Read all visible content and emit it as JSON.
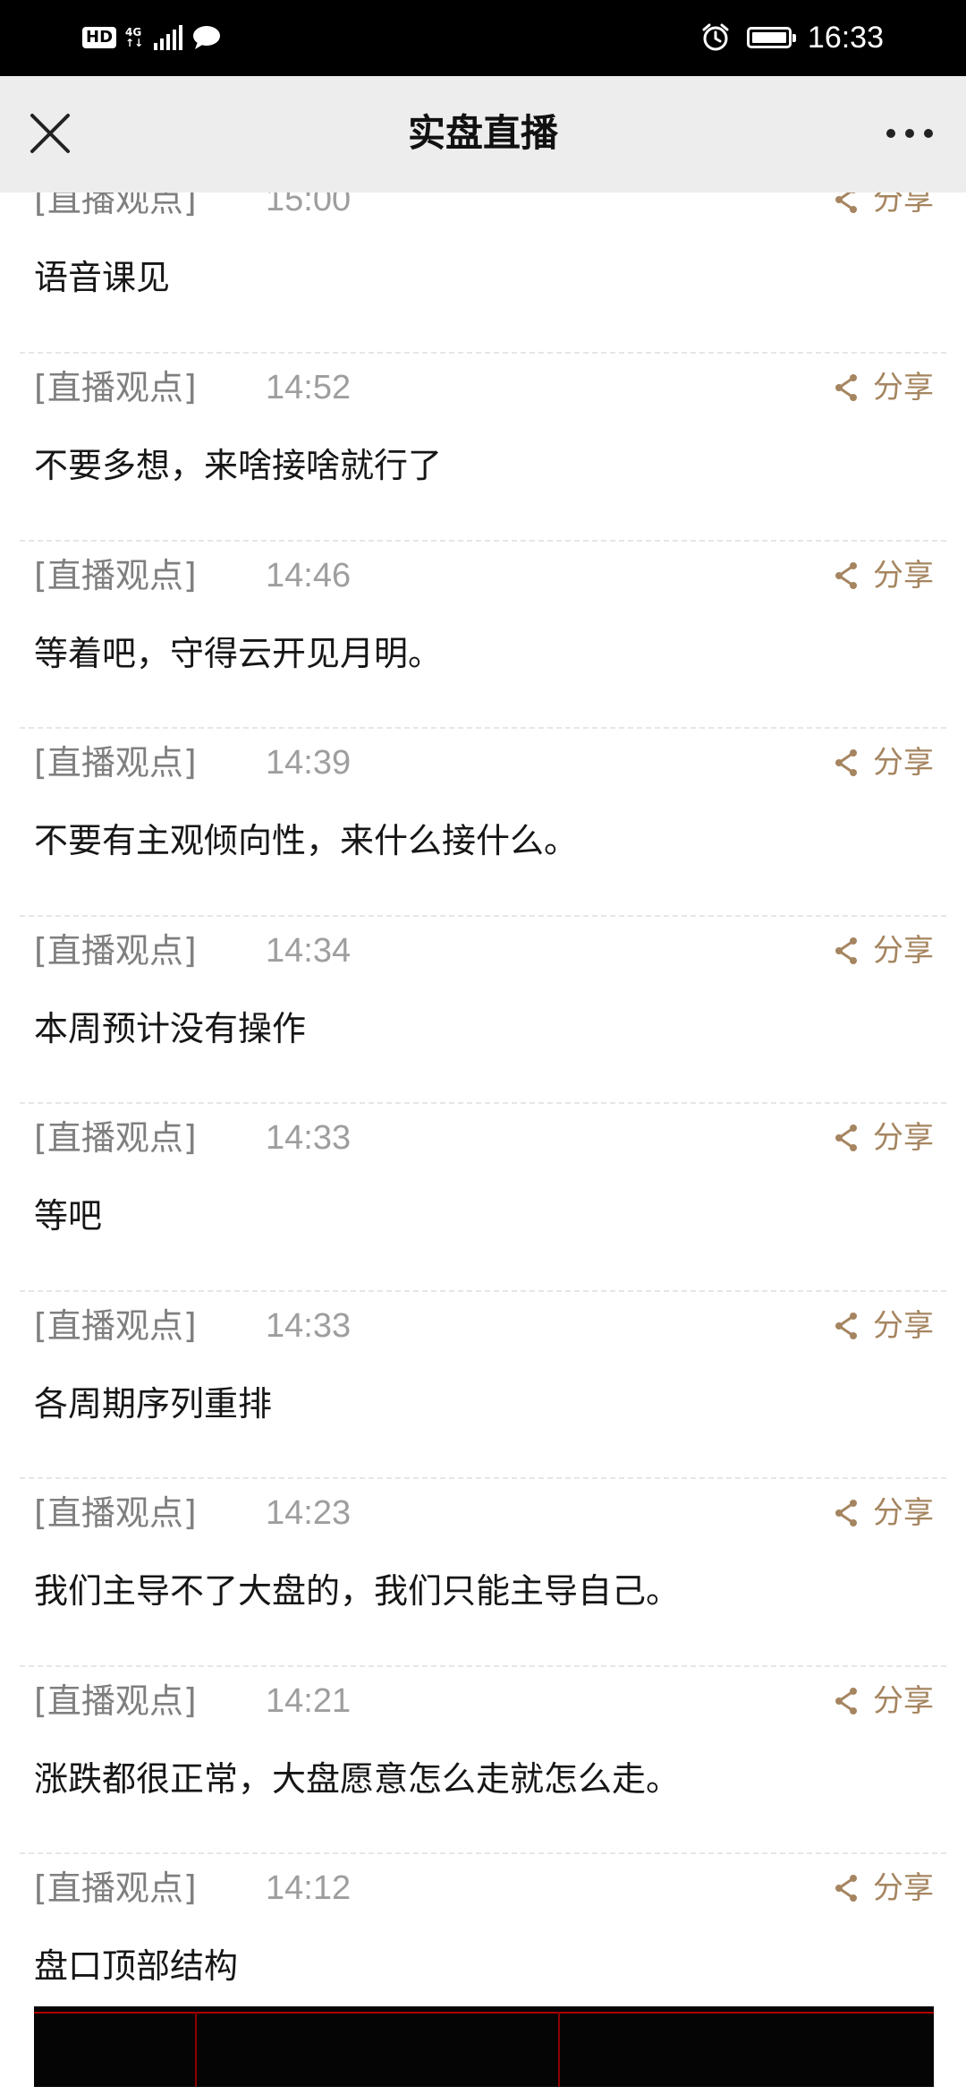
{
  "status_bar": {
    "hd": "HD",
    "network_top": "4G",
    "network_bottom": "↑↓",
    "time": "16:33"
  },
  "nav": {
    "title": "实盘直播"
  },
  "share_label": "分享",
  "posts": [
    {
      "tag": "[直播观点]",
      "time": "15:00",
      "text": "语音课见"
    },
    {
      "tag": "[直播观点]",
      "time": "14:52",
      "text": "不要多想，来啥接啥就行了"
    },
    {
      "tag": "[直播观点]",
      "time": "14:46",
      "text": "等着吧，守得云开见月明。"
    },
    {
      "tag": "[直播观点]",
      "time": "14:39",
      "text": "不要有主观倾向性，来什么接什么。"
    },
    {
      "tag": "[直播观点]",
      "time": "14:34",
      "text": "本周预计没有操作"
    },
    {
      "tag": "[直播观点]",
      "time": "14:33",
      "text": "等吧"
    },
    {
      "tag": "[直播观点]",
      "time": "14:33",
      "text": "各周期序列重排"
    },
    {
      "tag": "[直播观点]",
      "time": "14:23",
      "text": "我们主导不了大盘的，我们只能主导自己。"
    },
    {
      "tag": "[直播观点]",
      "time": "14:21",
      "text": "涨跌都很正常，大盘愿意怎么走就怎么走。"
    },
    {
      "tag": "[直播观点]",
      "time": "14:12",
      "text": "盘口顶部结构"
    }
  ],
  "colors": {
    "status_bar_bg": "#000000",
    "nav_bg": "#ededed",
    "share_accent": "#a58560",
    "tag_gray": "#7f7f7f",
    "divider": "#e6e6e6"
  },
  "icons": {
    "nav_left": "close-icon",
    "nav_right": "more-icon",
    "share": "share-icon",
    "status_right": [
      "alarm-icon",
      "battery-icon"
    ],
    "status_left": [
      "hd-icon",
      "signal-icon",
      "message-icon"
    ]
  }
}
